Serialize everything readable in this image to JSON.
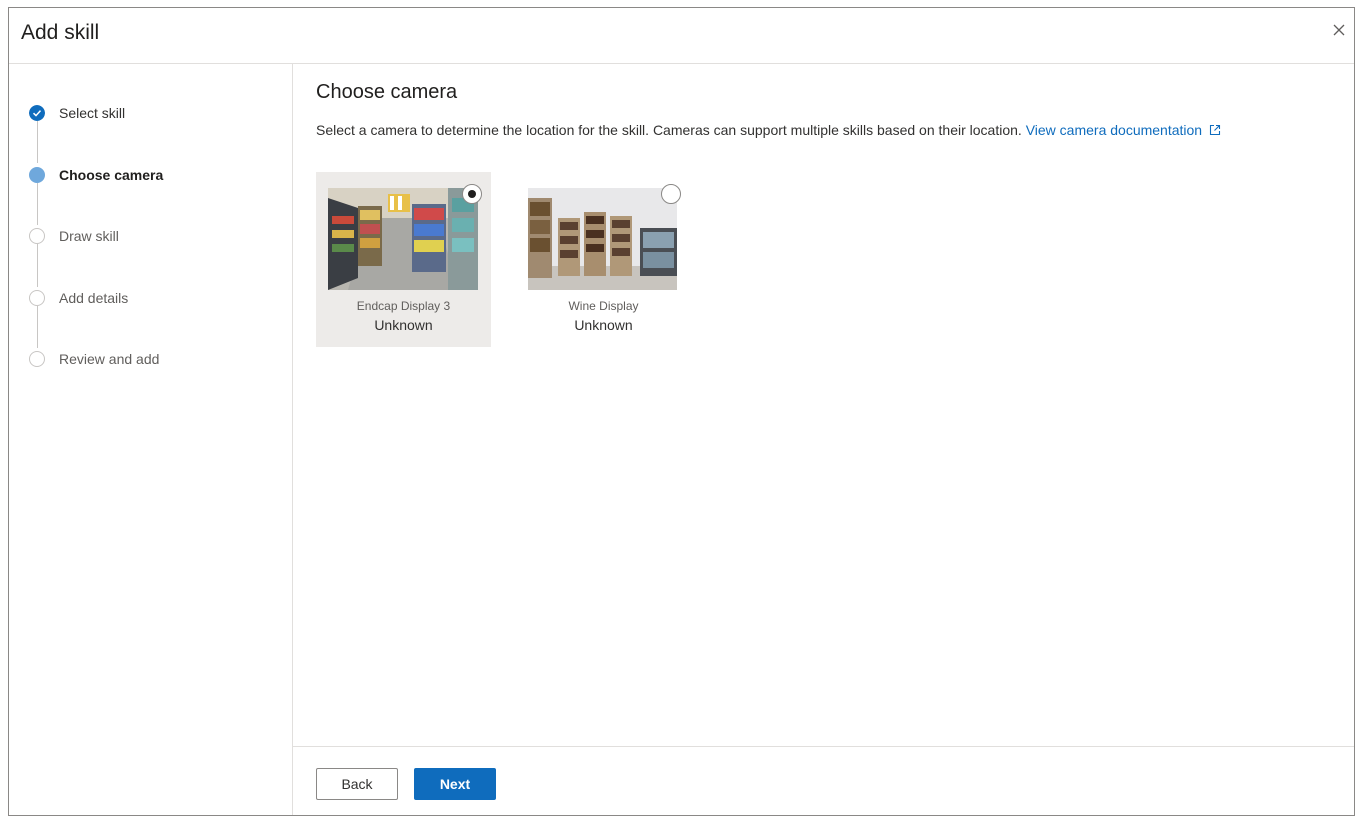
{
  "dialog": {
    "title": "Add skill",
    "close_icon": "close-icon"
  },
  "steps": [
    {
      "label": "Select skill",
      "state": "completed"
    },
    {
      "label": "Choose camera",
      "state": "current"
    },
    {
      "label": "Draw skill",
      "state": "pending"
    },
    {
      "label": "Add details",
      "state": "pending"
    },
    {
      "label": "Review and add",
      "state": "pending"
    }
  ],
  "main": {
    "title": "Choose camera",
    "description": "Select a camera to determine the location for the skill. Cameras can support multiple skills based on their location.",
    "doc_link": "View camera documentation",
    "doc_link_icon": "external-link-icon"
  },
  "cameras": [
    {
      "name": "Endcap Display 3",
      "status": "Unknown",
      "selected": true
    },
    {
      "name": "Wine Display",
      "status": "Unknown",
      "selected": false
    }
  ],
  "footer": {
    "back_label": "Back",
    "next_label": "Next"
  },
  "colors": {
    "accent": "#0f6cbd",
    "current_step": "#6fa8dc",
    "selected_card": "#edebe9"
  }
}
